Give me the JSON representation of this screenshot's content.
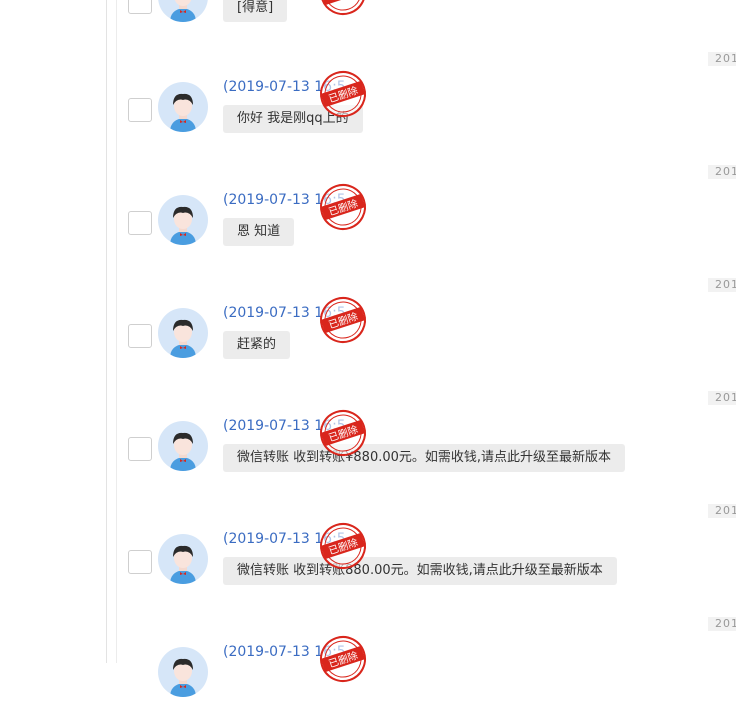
{
  "messages": [
    {
      "sender": "",
      "text": "[得意]",
      "stamp": "已删除",
      "date_tag": ""
    },
    {
      "sender": "(2019-07-13 16:5",
      "text": "你好 我是刚qq上的",
      "stamp": "已删除",
      "date_tag": "201"
    },
    {
      "sender": "(2019-07-13 16:5",
      "text": "恩 知道",
      "stamp": "已删除",
      "date_tag": "201"
    },
    {
      "sender": "(2019-07-13 16:5",
      "text": "赶紧的",
      "stamp": "已删除",
      "date_tag": "201"
    },
    {
      "sender": "(2019-07-13 16:5",
      "text": "微信转账 收到转账¥880.00元。如需收钱,请点此升级至最新版本",
      "stamp": "已删除",
      "date_tag": "201"
    },
    {
      "sender": "(2019-07-13 16:5",
      "text": "微信转账 收到转账880.00元。如需收钱,请点此升级至最新版本",
      "stamp": "已删除",
      "date_tag": "201"
    },
    {
      "sender": "(2019-07-13 16:5",
      "text": "",
      "stamp": "已删除",
      "date_tag": "201"
    }
  ],
  "colors": {
    "sender": "#3b6cc2",
    "stamp": "#d9261c",
    "bubble": "#ececec"
  }
}
